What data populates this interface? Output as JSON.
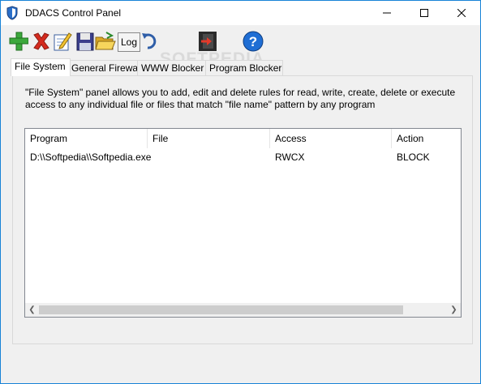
{
  "window": {
    "title": "DDACS Control Panel"
  },
  "toolbar": {
    "log_label": "Log",
    "buttons": [
      "add-icon",
      "delete-icon",
      "edit-icon",
      "save-icon",
      "open-folder-icon",
      "log-button",
      "undo-icon",
      "exit-icon",
      "help-icon"
    ]
  },
  "watermark": "SOFTPEDIA",
  "tabs": [
    "File System",
    "General Firewall",
    "WWW Blocker",
    "Program Blocker"
  ],
  "panel": {
    "description": "\"File System\" panel allows you to add, edit and delete rules for read, write, create, delete or execute access to any individual file or files that match \"file name\" pattern by any program"
  },
  "table": {
    "columns": [
      "Program",
      "File",
      "Access",
      "Action"
    ],
    "rows": [
      {
        "program": "D:\\\\Softpedia\\\\Softpedia.exe",
        "file": "",
        "access": "RWCX",
        "action": "BLOCK"
      }
    ]
  },
  "colors": {
    "accent": "#1883d7",
    "window_bg": "#f0f0f0"
  }
}
